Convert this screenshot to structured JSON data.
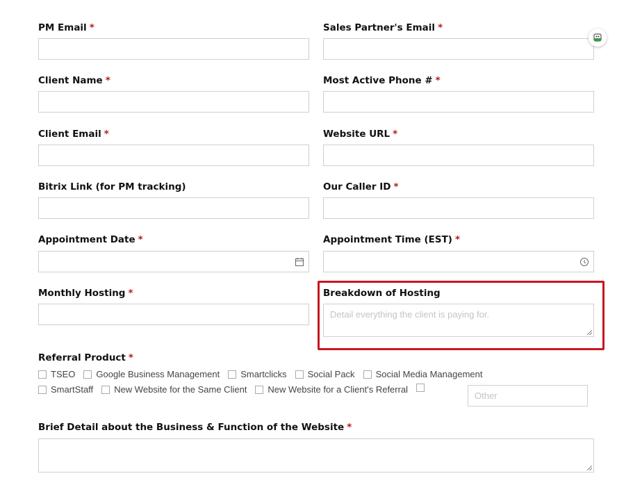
{
  "fields": {
    "pm_email": "PM Email",
    "sales_email": "Sales Partner's Email",
    "client_name": "Client Name",
    "phone": "Most Active Phone #",
    "client_email": "Client Email",
    "website": "Website URL",
    "bitrix": "Bitrix Link (for PM tracking)",
    "caller_id": "Our Caller ID",
    "appt_date": "Appointment Date",
    "appt_time": "Appointment Time (EST)",
    "monthly_hosting": "Monthly Hosting",
    "breakdown": "Breakdown of Hosting",
    "breakdown_placeholder": "Detail everything the client is paying for.",
    "referral": "Referral Product",
    "brief": "Brief Detail about the Business & Function of the Website"
  },
  "required_mark": "*",
  "referral_options": [
    "TSEO",
    "Google Business Management",
    "Smartclicks",
    "Social Pack",
    "Social Media Management",
    "SmartStaff",
    "New Website for the Same Client",
    "New Website for a Client's Referral"
  ],
  "other_placeholder": "Other",
  "highlight_color": "#c8171e"
}
